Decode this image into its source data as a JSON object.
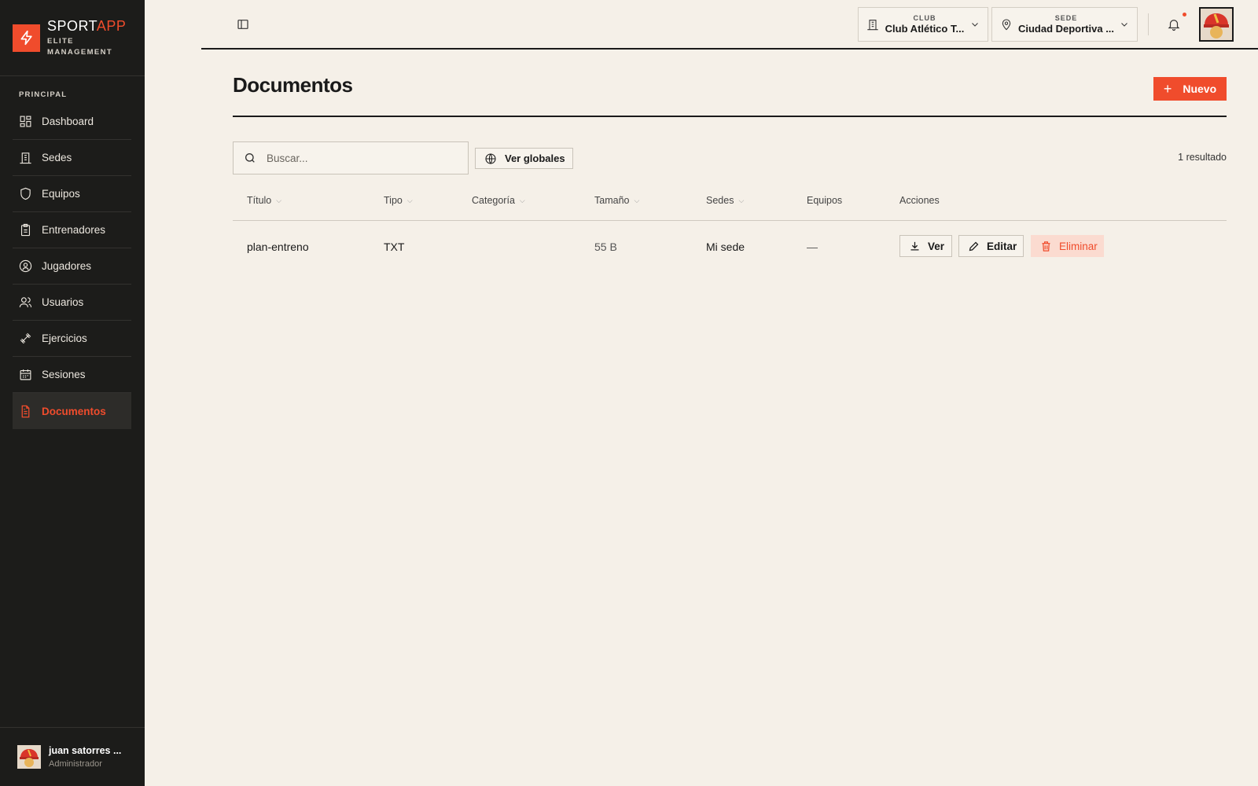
{
  "brand": {
    "name_main": "SPORT",
    "name_accent": "APP",
    "subtitle_line1": "ELITE",
    "subtitle_line2": "MANAGEMENT"
  },
  "sidebar": {
    "section_label": "PRINCIPAL",
    "items": [
      {
        "label": "Dashboard",
        "icon": "dashboard-icon"
      },
      {
        "label": "Sedes",
        "icon": "building-icon"
      },
      {
        "label": "Equipos",
        "icon": "shield-icon"
      },
      {
        "label": "Entrenadores",
        "icon": "clipboard-icon"
      },
      {
        "label": "Jugadores",
        "icon": "user-circle-icon"
      },
      {
        "label": "Usuarios",
        "icon": "users-icon"
      },
      {
        "label": "Ejercicios",
        "icon": "dumbbell-icon"
      },
      {
        "label": "Sesiones",
        "icon": "calendar-icon"
      },
      {
        "label": "Documentos",
        "icon": "document-icon",
        "active": true
      }
    ],
    "user": {
      "name": "juan satorres ...",
      "role": "Administrador"
    }
  },
  "header": {
    "club": {
      "label": "CLUB",
      "value": "Club Atlético T..."
    },
    "sede": {
      "label": "SEDE",
      "value": "Ciudad Deportiva ..."
    },
    "notification_dot": true
  },
  "page": {
    "title": "Documentos",
    "new_button_label": "Nuevo",
    "search_placeholder": "Buscar...",
    "globals_button_label": "Ver globales",
    "result_count": "1 resultado"
  },
  "table": {
    "columns": [
      "Título",
      "Tipo",
      "Categoría",
      "Tamaño",
      "Sedes",
      "Equipos",
      "Acciones"
    ],
    "rows": [
      {
        "titulo": "plan-entreno",
        "tipo": "TXT",
        "categoria": "",
        "tamano": "55 B",
        "sedes": "Mi sede",
        "equipos": "—",
        "actions": {
          "view": "Ver",
          "edit": "Editar",
          "delete": "Eliminar"
        }
      }
    ]
  },
  "colors": {
    "accent": "#f04c2c",
    "sidebar_bg": "#1c1c1a",
    "page_bg": "#f5f0e8"
  }
}
